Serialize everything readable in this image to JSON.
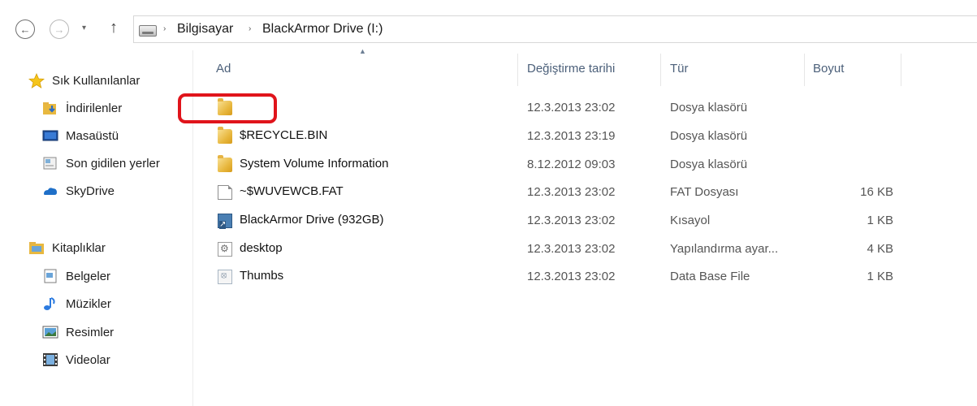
{
  "nav": {
    "back_icon": "←",
    "forward_icon": "→",
    "dropdown_icon": "▾",
    "up_icon": "↑",
    "separator_icon": "›",
    "breadcrumbs": [
      "Bilgisayar",
      "BlackArmor Drive (I:)"
    ]
  },
  "sidebar": {
    "favorites_label": "Sık Kullanılanlar",
    "favorites": [
      {
        "label": "İndirilenler",
        "icon": "downloads-icon"
      },
      {
        "label": "Masaüstü",
        "icon": "desktop-icon"
      },
      {
        "label": "Son gidilen yerler",
        "icon": "recent-places-icon"
      },
      {
        "label": "SkyDrive",
        "icon": "skydrive-icon"
      }
    ],
    "libraries_label": "Kitaplıklar",
    "libraries": [
      {
        "label": "Belgeler",
        "icon": "documents-icon"
      },
      {
        "label": "Müzikler",
        "icon": "music-icon"
      },
      {
        "label": "Resimler",
        "icon": "pictures-icon"
      },
      {
        "label": "Videolar",
        "icon": "videos-icon"
      }
    ]
  },
  "columns": {
    "name": "Ad",
    "date": "Değiştirme tarihi",
    "type": "Tür",
    "size": "Boyut",
    "sort_icon": "▲"
  },
  "files": [
    {
      "name": "",
      "date": "12.3.2013 23:02",
      "type": "Dosya klasörü",
      "size": "",
      "icon": "folder-icon"
    },
    {
      "name": "$RECYCLE.BIN",
      "date": "12.3.2013 23:19",
      "type": "Dosya klasörü",
      "size": "",
      "icon": "folder-icon"
    },
    {
      "name": "System Volume Information",
      "date": "8.12.2012 09:03",
      "type": "Dosya klasörü",
      "size": "",
      "icon": "folder-icon"
    },
    {
      "name": "~$WUVEWCB.FAT",
      "date": "12.3.2013 23:02",
      "type": "FAT Dosyası",
      "size": "16 KB",
      "icon": "document-icon"
    },
    {
      "name": "BlackArmor Drive (932GB)",
      "date": "12.3.2013 23:02",
      "type": "Kısayol",
      "size": "1 KB",
      "icon": "shortcut-icon"
    },
    {
      "name": "desktop",
      "date": "12.3.2013 23:02",
      "type": "Yapılandırma ayar...",
      "size": "4 KB",
      "icon": "config-file-icon"
    },
    {
      "name": "Thumbs",
      "date": "12.3.2013 23:02",
      "type": "Data Base File",
      "size": "1 KB",
      "icon": "database-file-icon"
    }
  ],
  "colors": {
    "highlight_ring": "#e0141b",
    "header_text": "#4c607a"
  }
}
